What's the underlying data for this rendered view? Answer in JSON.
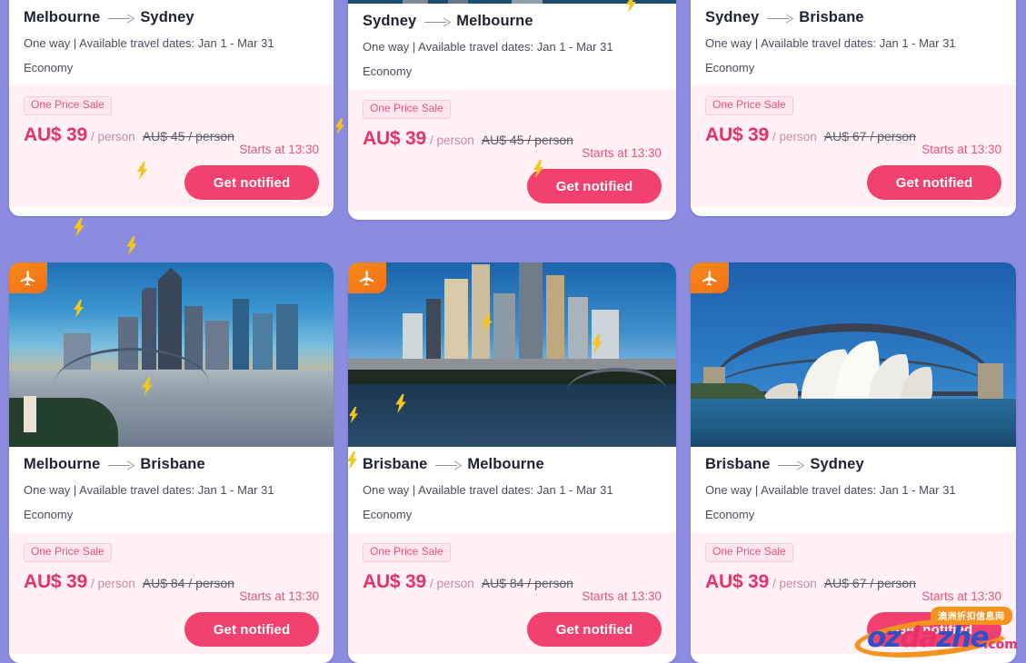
{
  "page": {
    "background_color": "#8b8ce0",
    "accent_pink": "#f2416f",
    "badge_orange": "#f6921e"
  },
  "common": {
    "route_arrow": "arrow-right-icon",
    "meta": "One way | Available travel dates: Jan 1 - Mar 31",
    "cabin": "Economy",
    "sale_tag": "One Price Sale",
    "price_unit": "/ person",
    "starts_at": "Starts at 13:30",
    "notify_label": "Get notified",
    "plane_icon": "airplane-icon"
  },
  "cards": [
    {
      "id": "melbourne-sydney",
      "origin": "Melbourne",
      "destination": "Sydney",
      "meta": "One way | Available travel dates: Jan 1 - Mar 31",
      "cabin": "Economy",
      "sale_tag": "One Price Sale",
      "price_now": "AU$ 39",
      "price_unit": "/ person",
      "price_was": "AU$ 45 / person",
      "starts_at": "Starts at 13:30",
      "notify_label": "Get notified",
      "photo": "melbourne-skyline-photo"
    },
    {
      "id": "sydney-melbourne",
      "origin": "Sydney",
      "destination": "Melbourne",
      "meta": "One way | Available travel dates: Jan 1 - Mar 31",
      "cabin": "Economy",
      "sale_tag": "One Price Sale",
      "price_now": "AU$ 39",
      "price_unit": "/ person",
      "price_was": "AU$ 45 / person",
      "starts_at": "Starts at 13:30",
      "notify_label": "Get notified",
      "photo": "sydney-skyline-photo"
    },
    {
      "id": "sydney-brisbane",
      "origin": "Sydney",
      "destination": "Brisbane",
      "meta": "One way | Available travel dates: Jan 1 - Mar 31",
      "cabin": "Economy",
      "sale_tag": "One Price Sale",
      "price_now": "AU$ 39",
      "price_unit": "/ person",
      "price_was": "AU$ 67 / person",
      "starts_at": "Starts at 13:30",
      "notify_label": "Get notified",
      "photo": "brisbane-photo"
    },
    {
      "id": "melbourne-brisbane",
      "origin": "Melbourne",
      "destination": "Brisbane",
      "meta": "One way | Available travel dates: Jan 1 - Mar 31",
      "cabin": "Economy",
      "sale_tag": "One Price Sale",
      "price_now": "AU$ 39",
      "price_unit": "/ person",
      "price_was": "AU$ 84 / person",
      "starts_at": "Starts at 13:30",
      "notify_label": "Get notified",
      "photo": "brisbane-river-sunset-photo"
    },
    {
      "id": "brisbane-melbourne",
      "origin": "Brisbane",
      "destination": "Melbourne",
      "meta": "One way | Available travel dates: Jan 1 - Mar 31",
      "cabin": "Economy",
      "sale_tag": "One Price Sale",
      "price_now": "AU$ 39",
      "price_unit": "/ person",
      "price_was": "AU$ 84 / person",
      "starts_at": "Starts at 13:30",
      "notify_label": "Get notified",
      "photo": "melbourne-yarra-river-photo"
    },
    {
      "id": "brisbane-sydney",
      "origin": "Brisbane",
      "destination": "Sydney",
      "meta": "One way | Available travel dates: Jan 1 - Mar 31",
      "cabin": "Economy",
      "sale_tag": "One Price Sale",
      "price_now": "AU$ 39",
      "price_unit": "/ person",
      "price_was": "AU$ 67 / person",
      "starts_at": "Starts at 13:30",
      "notify_label": "Get notified",
      "photo": "sydney-opera-house-harbour-bridge-photo"
    }
  ],
  "watermark": {
    "text_part_1": "oz",
    "text_part_2": "da",
    "text_part_3": "zhe",
    "suffix": ".com",
    "badge": "澳洲折扣信息网"
  }
}
